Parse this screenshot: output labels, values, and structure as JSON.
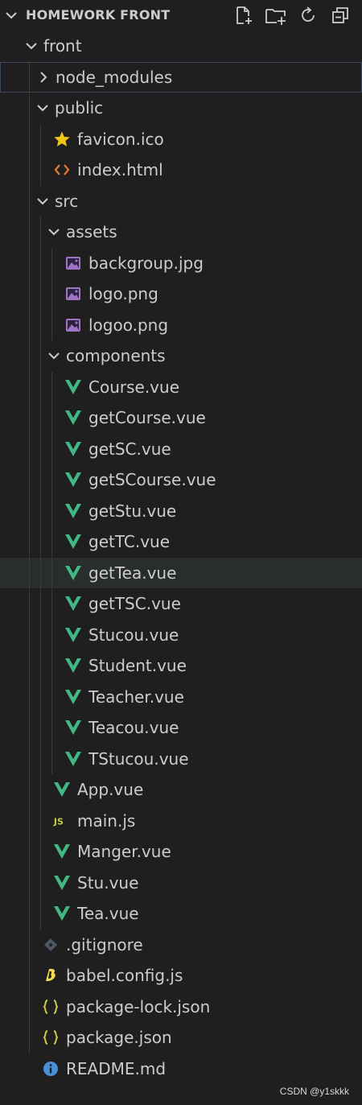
{
  "explorer": {
    "title": "HOMEWORK FRONT",
    "actions": [
      {
        "name": "new-file-icon"
      },
      {
        "name": "new-folder-icon"
      },
      {
        "name": "refresh-icon"
      },
      {
        "name": "collapse-all-icon"
      }
    ]
  },
  "tree": [
    {
      "label": "front",
      "type": "folder-open",
      "depth": 0
    },
    {
      "label": "node_modules",
      "type": "folder-closed",
      "depth": 1,
      "selected": true
    },
    {
      "label": "public",
      "type": "folder-open",
      "depth": 1
    },
    {
      "label": "favicon.ico",
      "type": "star",
      "depth": 2
    },
    {
      "label": "index.html",
      "type": "html",
      "depth": 2
    },
    {
      "label": "src",
      "type": "folder-open",
      "depth": 1
    },
    {
      "label": "assets",
      "type": "folder-open",
      "depth": 2
    },
    {
      "label": "backgroup.jpg",
      "type": "image",
      "depth": 3
    },
    {
      "label": "logo.png",
      "type": "image",
      "depth": 3
    },
    {
      "label": "logoo.png",
      "type": "image",
      "depth": 3
    },
    {
      "label": "components",
      "type": "folder-open",
      "depth": 2
    },
    {
      "label": "Course.vue",
      "type": "vue",
      "depth": 3
    },
    {
      "label": "getCourse.vue",
      "type": "vue",
      "depth": 3
    },
    {
      "label": "getSC.vue",
      "type": "vue",
      "depth": 3
    },
    {
      "label": "getSCourse.vue",
      "type": "vue",
      "depth": 3
    },
    {
      "label": "getStu.vue",
      "type": "vue",
      "depth": 3
    },
    {
      "label": "getTC.vue",
      "type": "vue",
      "depth": 3
    },
    {
      "label": "getTea.vue",
      "type": "vue",
      "depth": 3,
      "hover": true
    },
    {
      "label": "getTSC.vue",
      "type": "vue",
      "depth": 3
    },
    {
      "label": "Stucou.vue",
      "type": "vue",
      "depth": 3
    },
    {
      "label": "Student.vue",
      "type": "vue",
      "depth": 3
    },
    {
      "label": "Teacher.vue",
      "type": "vue",
      "depth": 3
    },
    {
      "label": "Teacou.vue",
      "type": "vue",
      "depth": 3
    },
    {
      "label": "TStucou.vue",
      "type": "vue",
      "depth": 3
    },
    {
      "label": "App.vue",
      "type": "vue",
      "depth": 2
    },
    {
      "label": "main.js",
      "type": "js",
      "depth": 2
    },
    {
      "label": "Manger.vue",
      "type": "vue",
      "depth": 2
    },
    {
      "label": "Stu.vue",
      "type": "vue",
      "depth": 2
    },
    {
      "label": "Tea.vue",
      "type": "vue",
      "depth": 2
    },
    {
      "label": ".gitignore",
      "type": "git",
      "depth": 1
    },
    {
      "label": "babel.config.js",
      "type": "babel",
      "depth": 1
    },
    {
      "label": "package-lock.json",
      "type": "json",
      "depth": 1
    },
    {
      "label": "package.json",
      "type": "json",
      "depth": 1
    },
    {
      "label": "README.md",
      "type": "info",
      "depth": 1
    }
  ],
  "watermark": "CSDN @y1skkk",
  "colors": {
    "background": "#1f1f1f",
    "text": "#cccccc",
    "vue": "#41b883",
    "js": "#cbcb41",
    "html": "#e37933",
    "image": "#a074c4",
    "star": "#f0c419",
    "info": "#4a90d9"
  }
}
